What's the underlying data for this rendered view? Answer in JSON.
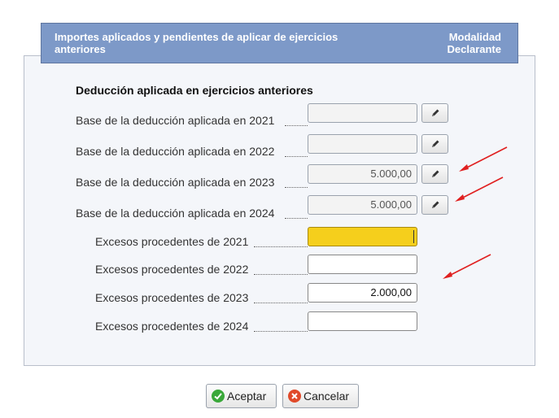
{
  "header": {
    "title_line1": "Importes aplicados y pendientes de aplicar de ejercicios",
    "title_line2": "anteriores",
    "mode_line1": "Modalidad",
    "mode_line2": "Declarante"
  },
  "section": {
    "title": "Deducción aplicada en ejercicios anteriores"
  },
  "deductions": [
    {
      "label": "Base de la deducción aplicada en 2021",
      "value": ""
    },
    {
      "label": "Base de la deducción aplicada en 2022",
      "value": ""
    },
    {
      "label": "Base de la deducción aplicada en 2023",
      "value": "5.000,00"
    },
    {
      "label": "Base de la deducción aplicada en 2024",
      "value": "5.000,00"
    }
  ],
  "excesses": [
    {
      "label": "Excesos procedentes de 2021",
      "value": ""
    },
    {
      "label": "Excesos procedentes de 2022",
      "value": ""
    },
    {
      "label": "Excesos procedentes de 2023",
      "value": "2.000,00"
    },
    {
      "label": "Excesos procedentes de 2024",
      "value": ""
    }
  ],
  "buttons": {
    "accept": "Aceptar",
    "cancel": "Cancelar"
  },
  "colors": {
    "header_bg": "#7d99c8",
    "focused_field": "#f5cf1c",
    "annotation_arrow": "#e02020"
  },
  "icons": {
    "edit": "pencil-icon",
    "accept": "check-circle-icon",
    "cancel": "x-circle-icon"
  }
}
